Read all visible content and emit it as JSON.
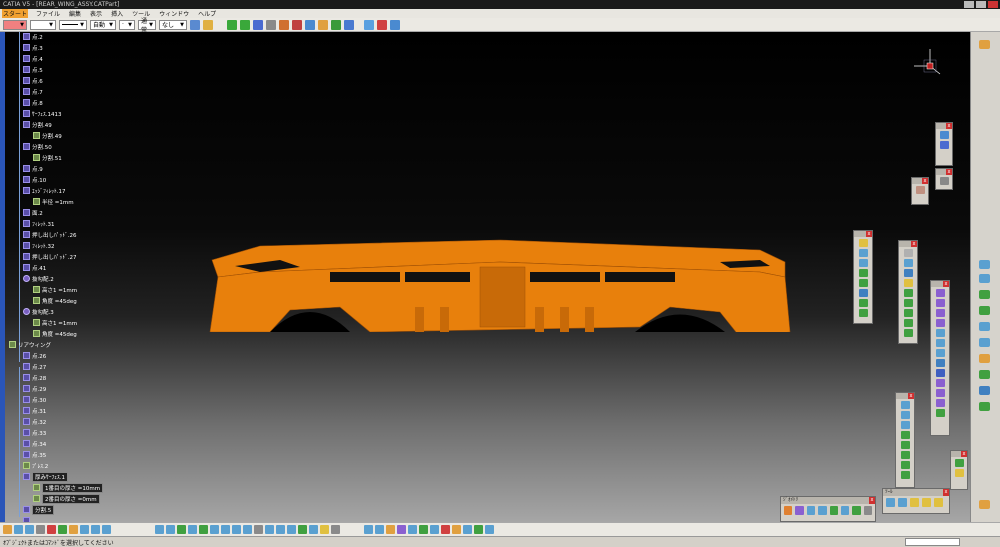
{
  "window": {
    "title": "CATIA V5 - [REAR_WING_ASSY.CATPart]"
  },
  "menu": [
    "スタート",
    "ファイル",
    "編集",
    "表示",
    "挿入",
    "ツール",
    "ウィンドウ",
    "ヘルプ"
  ],
  "toolbar": {
    "color_value": "",
    "line_type_value": "",
    "weight_value": "自動",
    "layer_value": "通常",
    "layer2_value": "なし"
  },
  "tree": {
    "items": [
      {
        "label": "点.2",
        "kind": "sketch"
      },
      {
        "label": "点.3",
        "kind": "sketch"
      },
      {
        "label": "点.4",
        "kind": "sketch"
      },
      {
        "label": "点.5",
        "kind": "sketch"
      },
      {
        "label": "点.6",
        "kind": "sketch"
      },
      {
        "label": "点.7",
        "kind": "sketch"
      },
      {
        "label": "点.8",
        "kind": "sketch"
      },
      {
        "label": "ｻｰﾌｪｽ.1413",
        "kind": "sketch"
      },
      {
        "label": "分割.49",
        "kind": "sketch"
      },
      {
        "label": "分割.49",
        "kind": "doc",
        "indent": true
      },
      {
        "label": "分割.50",
        "kind": "sketch"
      },
      {
        "label": "分割.51",
        "kind": "doc",
        "indent": true
      },
      {
        "label": "点.9",
        "kind": "sketch"
      },
      {
        "label": "点.10",
        "kind": "sketch"
      },
      {
        "label": "ｴｯｼﾞﾌｨﾚｯﾄ.17",
        "kind": "sketch"
      },
      {
        "label": "半径 =1mm",
        "kind": "doc",
        "indent": true
      },
      {
        "label": "面.2",
        "kind": "sketch"
      },
      {
        "label": "ﾌｨﾚｯﾄ.31",
        "kind": "sketch"
      },
      {
        "label": "押し出しﾊﾟｯﾄﾞ.26",
        "kind": "sketch"
      },
      {
        "label": "ﾌｨﾚｯﾄ.32",
        "kind": "sketch"
      },
      {
        "label": "押し出しﾊﾟｯﾄﾞ.27",
        "kind": "sketch"
      },
      {
        "label": "点.41",
        "kind": "sketch"
      },
      {
        "label": "抜勾配.2",
        "kind": "feat"
      },
      {
        "label": "高さ1 =1mm",
        "kind": "doc",
        "indent": true
      },
      {
        "label": "角度 =45deg",
        "kind": "doc",
        "indent": true
      },
      {
        "label": "抜勾配.3",
        "kind": "feat"
      },
      {
        "label": "高さ1 =1mm",
        "kind": "doc",
        "indent": true
      },
      {
        "label": "角度 =45deg",
        "kind": "doc",
        "indent": true
      },
      {
        "label": "リアウィング",
        "kind": "doc",
        "root": true
      },
      {
        "label": "点.26",
        "kind": "sketch"
      },
      {
        "label": "点.27",
        "kind": "sketch"
      },
      {
        "label": "点.28",
        "kind": "sketch"
      },
      {
        "label": "点.29",
        "kind": "sketch"
      },
      {
        "label": "点.30",
        "kind": "sketch"
      },
      {
        "label": "点.31",
        "kind": "sketch"
      },
      {
        "label": "点.32",
        "kind": "sketch"
      },
      {
        "label": "点.33",
        "kind": "sketch"
      },
      {
        "label": "点.34",
        "kind": "sketch"
      },
      {
        "label": "点.35",
        "kind": "sketch"
      },
      {
        "label": "ﾌﾟﾚｽ.2",
        "kind": "doc"
      },
      {
        "label": "厚みｻｰﾌｪｽ.1",
        "kind": "sketch",
        "boxed": true
      },
      {
        "label": "1番目の厚さ =10mm",
        "kind": "doc",
        "indent": true,
        "boxed": true
      },
      {
        "label": "2番目の厚さ =0mm",
        "kind": "doc",
        "indent": true,
        "boxed": true
      },
      {
        "label": "分割.5",
        "kind": "sketch",
        "boxed": true
      },
      {
        "label": "",
        "kind": "sketch"
      }
    ]
  },
  "status": {
    "message": "ｵﾌﾞｼﾞｪｸﾄまたはｺﾏﾝﾄﾞを選択してください"
  },
  "floating_toolbars": {
    "bottom_title": "ｼﾞｵﾒﾄﾘ",
    "bottom2_title": "ﾂｰﾙ"
  },
  "colors": {
    "part": "#e8800c",
    "part_dark": "#b45a05",
    "accent": "#f0a030"
  }
}
